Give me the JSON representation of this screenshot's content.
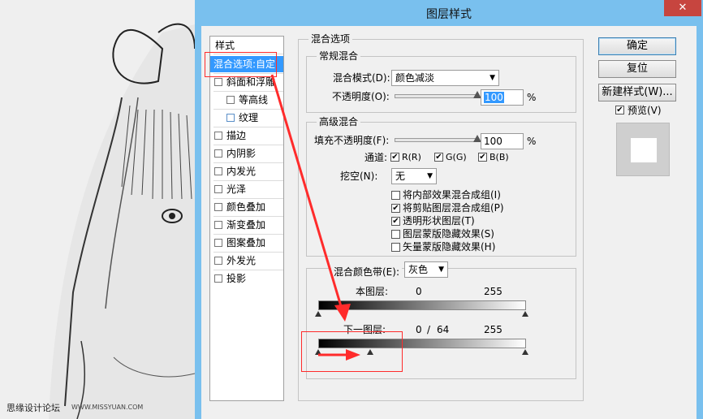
{
  "watermark": {
    "site_cn": "思缘设计论坛",
    "site_url": "WWW.MISSYUAN.COM"
  },
  "dialog": {
    "title": "图层样式",
    "close_glyph": "✕"
  },
  "styles_list": {
    "header": "样式",
    "items": [
      {
        "label": "混合选项:自定",
        "selected": true,
        "checkbox": false
      },
      {
        "label": "斜面和浮雕",
        "checkbox": true,
        "checked": false
      },
      {
        "label": "等高线",
        "checkbox": true,
        "checked": false,
        "indent": true
      },
      {
        "label": "纹理",
        "checkbox": true,
        "checked": false,
        "indent": true
      },
      {
        "label": "描边",
        "checkbox": true,
        "checked": false
      },
      {
        "label": "内阴影",
        "checkbox": true,
        "checked": false
      },
      {
        "label": "内发光",
        "checkbox": true,
        "checked": false
      },
      {
        "label": "光泽",
        "checkbox": true,
        "checked": false
      },
      {
        "label": "颜色叠加",
        "checkbox": true,
        "checked": false
      },
      {
        "label": "渐变叠加",
        "checkbox": true,
        "checked": false
      },
      {
        "label": "图案叠加",
        "checkbox": true,
        "checked": false
      },
      {
        "label": "外发光",
        "checkbox": true,
        "checked": false
      },
      {
        "label": "投影",
        "checkbox": true,
        "checked": false
      }
    ]
  },
  "blending_options": {
    "title": "混合选项",
    "general": {
      "title": "常规混合",
      "blend_mode_label": "混合模式(D):",
      "blend_mode_value": "颜色减淡",
      "opacity_label": "不透明度(O):",
      "opacity_value": "100",
      "opacity_unit": "%",
      "opacity_level": 1.0
    },
    "advanced": {
      "title": "高级混合",
      "fill_opacity_label": "填充不透明度(F):",
      "fill_opacity_value": "100",
      "fill_opacity_unit": "%",
      "fill_level": 1.0,
      "channels_label": "通道:",
      "channels": [
        {
          "label": "R(R)",
          "checked": true
        },
        {
          "label": "G(G)",
          "checked": true
        },
        {
          "label": "B(B)",
          "checked": true
        }
      ],
      "knockout_label": "挖空(N):",
      "knockout_value": "无",
      "options": [
        {
          "label": "将内部效果混合成组(I)",
          "checked": false
        },
        {
          "label": "将剪贴图层混合成组(P)",
          "checked": true
        },
        {
          "label": "透明形状图层(T)",
          "checked": true
        },
        {
          "label": "图层蒙版隐藏效果(S)",
          "checked": false
        },
        {
          "label": "矢量蒙版隐藏效果(H)",
          "checked": false
        }
      ]
    },
    "blend_if": {
      "label": "混合颜色带(E):",
      "value": "灰色",
      "this_layer_label": "本图层:",
      "this_layer_low": "0",
      "this_layer_high": "255",
      "this_layer_stops": [
        0,
        255
      ],
      "underlying_label": "下一图层:",
      "underlying_low": "0",
      "underlying_sep": "/",
      "underlying_split": "64",
      "underlying_high": "255",
      "underlying_stops": [
        0,
        64,
        255
      ]
    }
  },
  "buttons": {
    "ok": "确定",
    "reset": "复位",
    "new_style": "新建样式(W)...",
    "preview_label": "预览(V)",
    "preview_checked": true
  },
  "colors": {
    "title_bar": "#79c0ee",
    "selection": "#3399ff",
    "annotation": "#ff2b2b",
    "close": "#c7453f"
  }
}
